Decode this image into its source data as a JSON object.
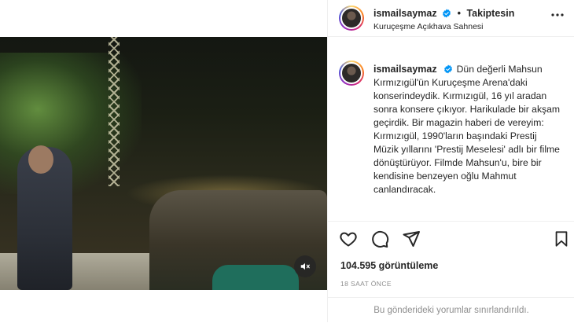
{
  "post": {
    "author": {
      "username": "ismailsaymaz",
      "verified": true,
      "follow_label": "Takiptesin",
      "location": "Kuruçeşme Açıkhava Sahnesi"
    },
    "caption": {
      "username": "ismailsaymaz",
      "text": "Dün değerli Mahsun Kırmızıgül'ün Kuruçeşme Arena'daki konserindeydik. Kırmızıgül, 16 yıl aradan sonra konsere çıkıyor. Harikulade bir akşam geçirdik. Bir magazin haberi de vereyim: Kırmızıgül, 1990'ların başındaki Prestij Müzik yıllarını 'Prestij Meselesi' adlı bir filme dönüştürüyor. Filmde Mahsun'u, bire bir kendisine benzeyen oğlu Mahmut canlandıracak."
    },
    "views_label": "104.595 görüntüleme",
    "time_label": "18 SAAT ÖNCE",
    "comments_limited_label": "Bu gönderideki yorumlar sınırlandırıldı.",
    "icons": {
      "more": "more-horizontal-icon",
      "like": "heart-icon",
      "comment": "comment-icon",
      "share": "paper-plane-icon",
      "save": "bookmark-icon",
      "mute": "speaker-muted-icon",
      "verified": "verified-badge-icon"
    },
    "colors": {
      "verified_blue": "#0095f6",
      "text_primary": "#262626",
      "text_secondary": "#8e8e8e",
      "divider": "#efefef"
    }
  }
}
